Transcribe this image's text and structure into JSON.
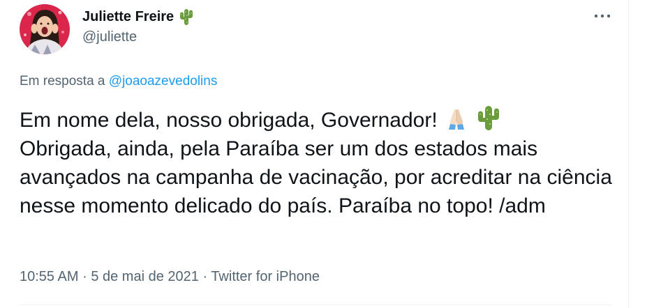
{
  "author": {
    "display_name": "Juliette Freire",
    "handle": "@juliette",
    "badge_icon": "cactus-emoji"
  },
  "reply": {
    "prefix": "Em resposta a",
    "mention": "@joaoazevedolins"
  },
  "tweet": {
    "line1_text": "Em nome dela, nosso obrigada, Governador!",
    "line1_emojis": [
      "folded-hands-emoji",
      "cactus-emoji"
    ],
    "body_text": "Obrigada, ainda, pela Paraíba ser um dos estados mais avançados na campanha de vacinação, por acreditar na ciência nesse momento delicado do país. Paraíba no topo! /adm"
  },
  "meta": {
    "time": "10:55 AM",
    "separator": "·",
    "date": "5 de mai de 2021",
    "source": "Twitter for iPhone"
  },
  "colors": {
    "text": "#0f1419",
    "secondary": "#536471",
    "accent": "#1d9bf0",
    "divider": "#eff3f4"
  }
}
